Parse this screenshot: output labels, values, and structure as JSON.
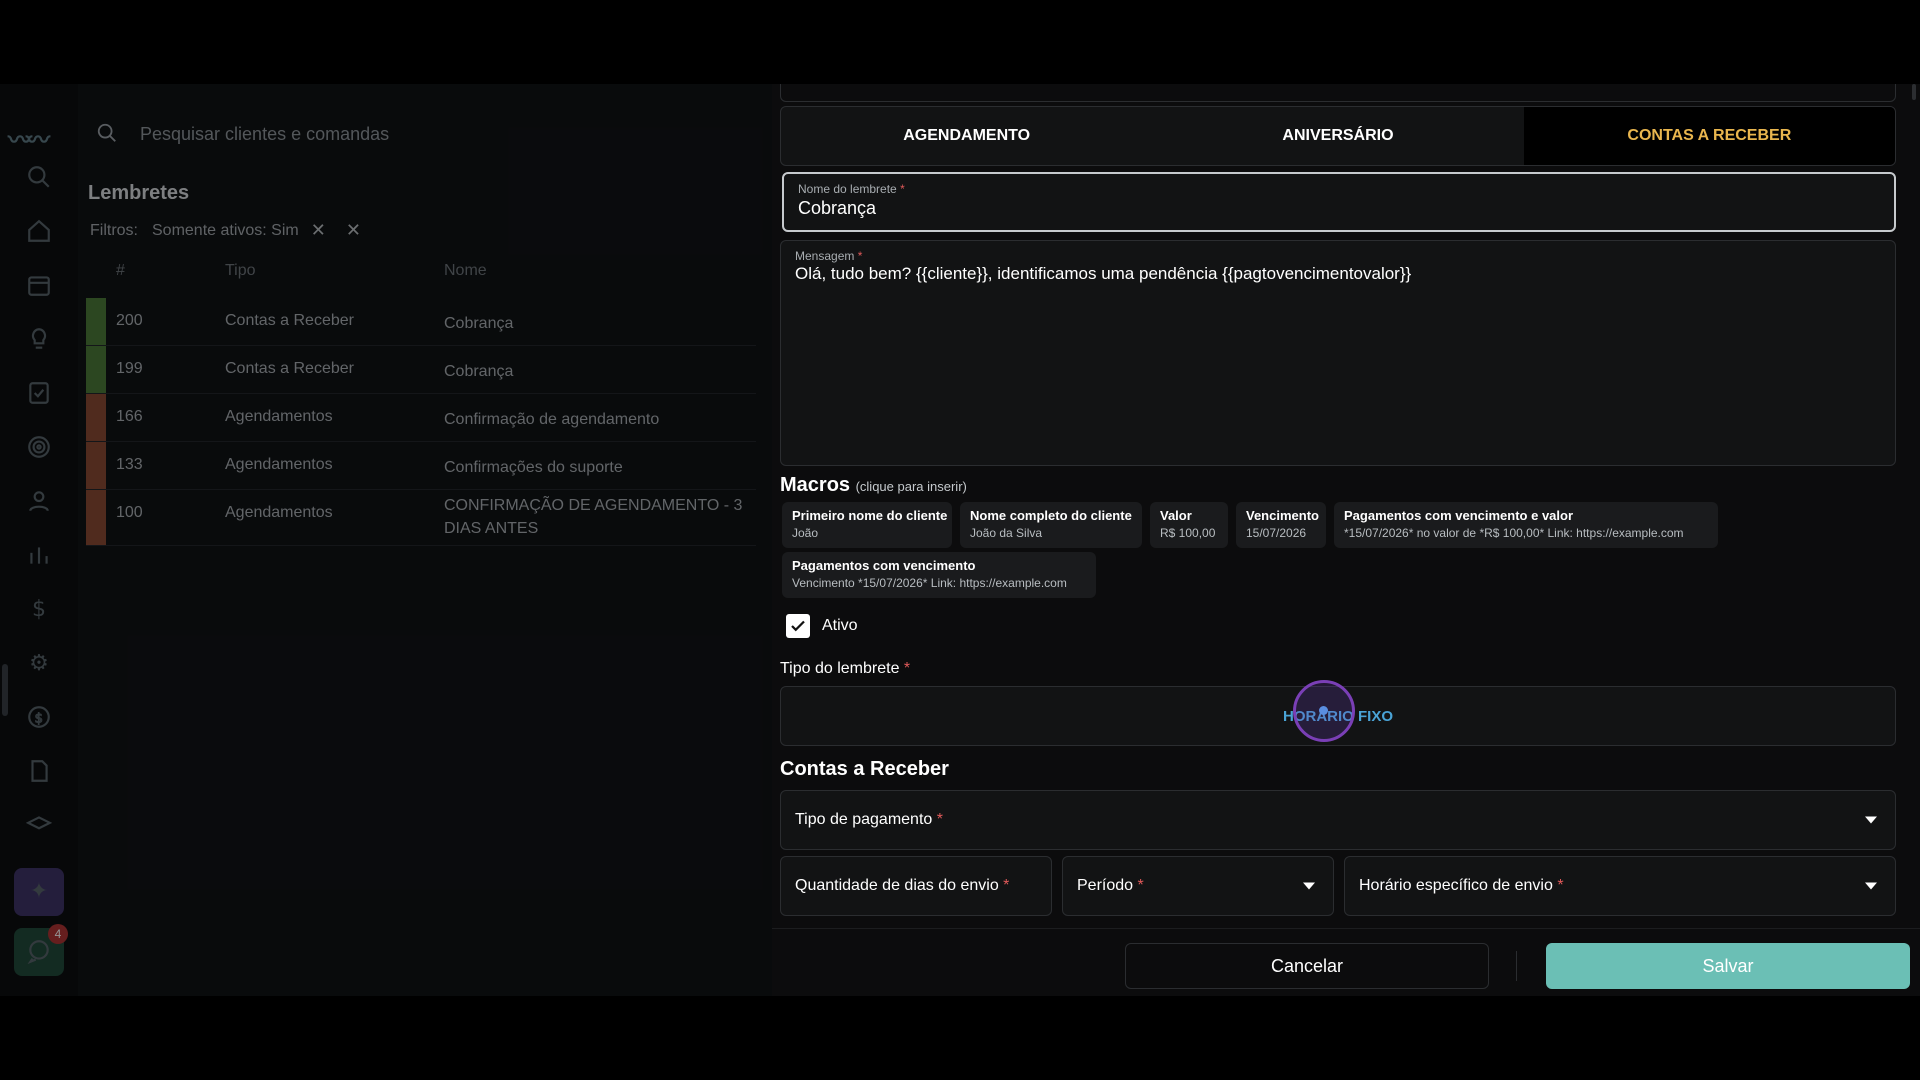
{
  "search": {
    "placeholder": "Pesquisar clientes e comandas"
  },
  "list": {
    "title": "Lembretes",
    "filters_label": "Filtros:",
    "filter_chip": "Somente ativos: Sim",
    "columns": [
      "#",
      "Tipo",
      "Nome"
    ],
    "rows": [
      {
        "id": "200",
        "tipo": "Contas a Receber",
        "nome": "Cobrança",
        "color": "#4c7a3a"
      },
      {
        "id": "199",
        "tipo": "Contas a Receber",
        "nome": "Cobrança",
        "color": "#4c7a3a"
      },
      {
        "id": "166",
        "tipo": "Agendamentos",
        "nome": "Confirmação de agendamento",
        "color": "#8a4a35"
      },
      {
        "id": "133",
        "tipo": "Agendamentos",
        "nome": "Confirmações do suporte",
        "color": "#8a4a35"
      },
      {
        "id": "100",
        "tipo": "Agendamentos",
        "nome": "CONFIRMAÇÃO DE AGENDAMENTO - 3 DIAS ANTES",
        "color": "#8a4a35"
      }
    ]
  },
  "sidebar": {
    "chat_badge": "4"
  },
  "tabs": [
    {
      "label": "AGENDAMENTO",
      "active": false
    },
    {
      "label": "ANIVERSÁRIO",
      "active": false
    },
    {
      "label": "CONTAS A RECEBER",
      "active": true
    }
  ],
  "form": {
    "name_label": "Nome do lembrete",
    "name_value": "Cobrança",
    "message_label": "Mensagem",
    "message_value": "Olá, tudo bem? {{cliente}}, identificamos uma pendência {{pagtovencimentovalor}}",
    "macros_title": "Macros",
    "macros_hint": "(clique para inserir)",
    "macros": [
      {
        "title": "Primeiro nome do cliente",
        "value": "João"
      },
      {
        "title": "Nome completo do cliente",
        "value": "João da Silva"
      },
      {
        "title": "Valor",
        "value": "R$ 100,00"
      },
      {
        "title": "Vencimento",
        "value": "15/07/2026"
      },
      {
        "title": "Pagamentos com vencimento e valor",
        "value": "*15/07/2026* no valor de *R$ 100,00* Link: https://example.com"
      },
      {
        "title": "Pagamentos com vencimento",
        "value": "Vencimento *15/07/2026* Link: https://example.com"
      }
    ],
    "active_label": "Ativo",
    "active_checked": true,
    "type_label": "Tipo do lembrete",
    "type_option": "HORÁRIO FIXO",
    "section_title": "Contas a Receber",
    "payment_type_label": "Tipo de pagamento",
    "days_label": "Quantidade de dias do envio",
    "period_label": "Período",
    "time_label": "Horário específico de envio",
    "required_mark": "*"
  },
  "footer": {
    "cancel_label": "Cancelar",
    "save_label": "Salvar"
  },
  "colors": {
    "accent_tab": "#e9b64e",
    "save": "#6bbfb5",
    "option": "#4aa3d6",
    "required": "#e15a5a"
  }
}
